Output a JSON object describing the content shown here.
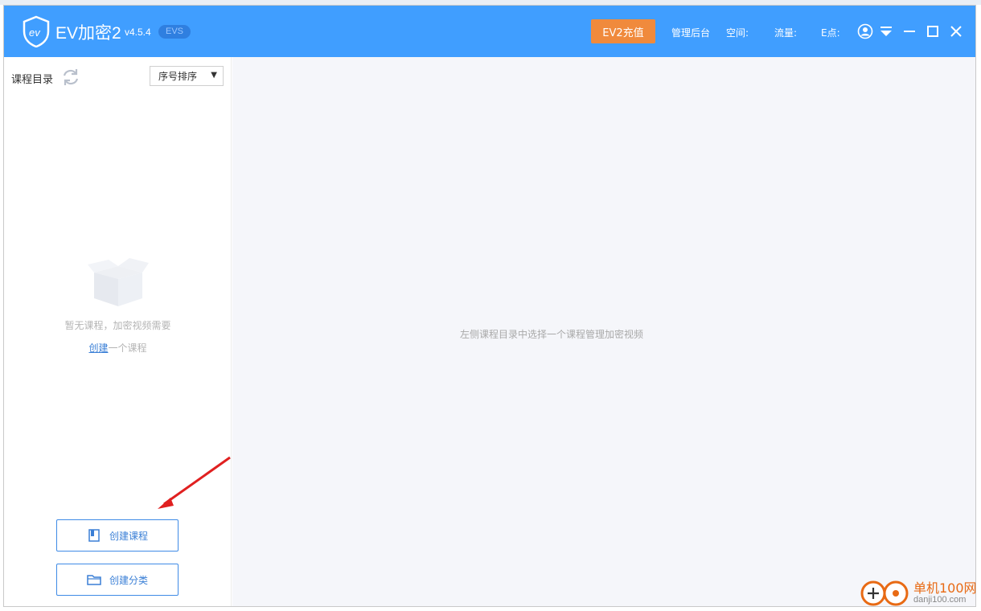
{
  "app": {
    "name": "EV加密2",
    "version": "v4.5.4",
    "edition_badge": "EVS"
  },
  "titlebar": {
    "recharge_label": "EV2充值",
    "admin_link": "管理后台",
    "space_label": "空间:",
    "traffic_label": "流量:",
    "epoints_label": "E点:"
  },
  "sidebar": {
    "catalog_label": "课程目录",
    "sort_selected": "序号排序",
    "empty_text": "暂无课程，加密视频需要",
    "create_link": "创建",
    "create_suffix": "一个课程",
    "create_course_label": "创建课程",
    "create_category_label": "创建分类"
  },
  "main": {
    "hint": "左侧课程目录中选择一个课程管理加密视频"
  },
  "watermark": {
    "cn": "单机100网",
    "en": "danji100.com"
  },
  "colors": {
    "titlebar": "#409eff",
    "recharge": "#f08a3c",
    "accent_blue": "#3a7fd6",
    "arrow_red": "#e02020"
  }
}
